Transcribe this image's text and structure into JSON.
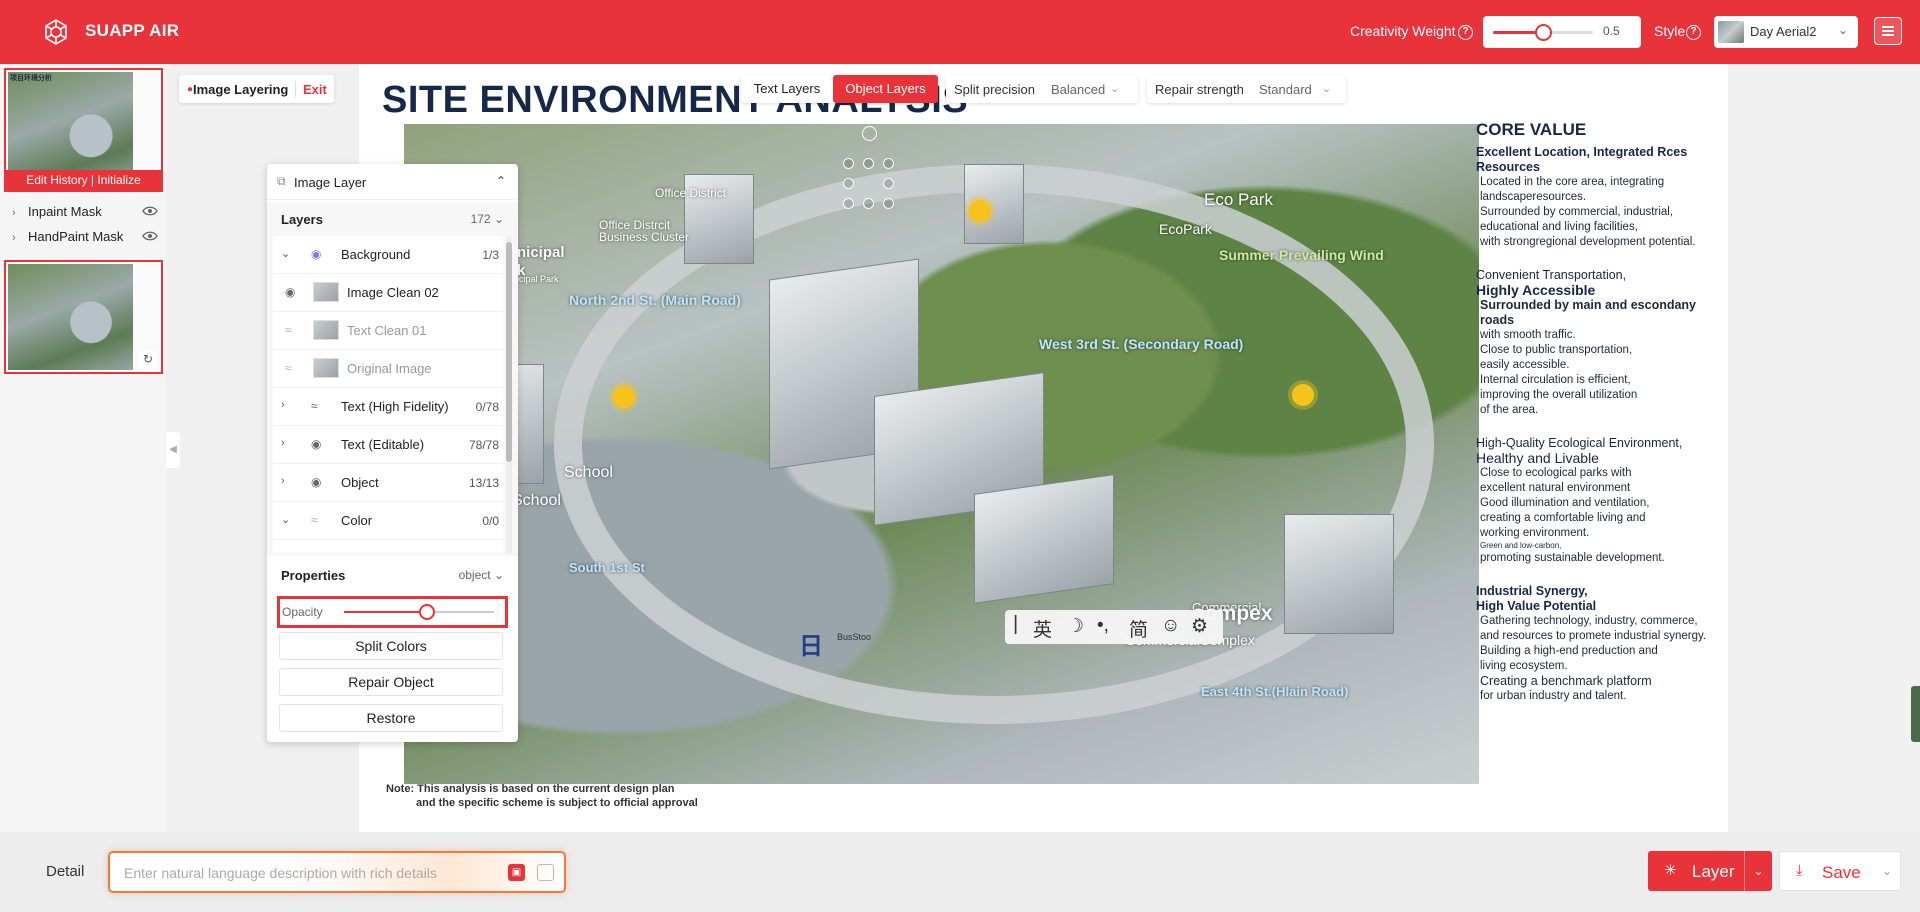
{
  "app": {
    "brand": "SUAPP AIR"
  },
  "header": {
    "creativity_label": "Creativity Weight",
    "creativity_value": "0.5",
    "creativity_fraction": 0.5,
    "style_label": "Style",
    "style_value": "Day Aerial2",
    "accent_color": "#e8333a"
  },
  "history": {
    "banner": "Edit History | Initialize",
    "thumb_title": "项目环境分析",
    "masks": [
      {
        "label": "Inpaint Mask"
      },
      {
        "label": "HandPaint Mask"
      }
    ]
  },
  "mode": {
    "label": "Image Layering",
    "exit": "Exit"
  },
  "toolbar": {
    "text_layers": "Text Layers",
    "object_layers": "Object Layers",
    "split_label": "Split precision",
    "split_value": "Balanced",
    "repair_label": "Repair strength",
    "repair_value": "Standard"
  },
  "layer_panel": {
    "title": "Image Layer",
    "layers_title": "Layers",
    "layers_count": "172",
    "rows": [
      {
        "name": "Background",
        "count": "1/3"
      },
      {
        "name": "Image Clean 02",
        "count": ""
      },
      {
        "name": "Text Clean 01",
        "count": ""
      },
      {
        "name": "Original Image",
        "count": ""
      },
      {
        "name": "Text (High Fidelity)",
        "count": "0/78"
      },
      {
        "name": "Text (Editable)",
        "count": "78/78"
      },
      {
        "name": "Object",
        "count": "13/13"
      },
      {
        "name": "Color",
        "count": "0/0"
      }
    ],
    "properties_title": "Properties",
    "properties_value": "object",
    "opacity_label": "Opacity",
    "opacity_fraction": 0.55,
    "buttons": {
      "split": "Split Colors",
      "repair": "Repair Object",
      "restore": "Restore"
    }
  },
  "canvas": {
    "title": "SITE ENVIRONMENT ANALYSIS",
    "labels": {
      "eco_park": "Eco Park",
      "eco_park2": "EcoPark",
      "office": "Office Distrcit",
      "office2": "Business Cluster",
      "office_icon": "Office District",
      "municipal": "nicipal",
      "municipal2": "k",
      "municipal_park": "icipal Park",
      "north_road": "North 2nd St. (Main Road)",
      "west_road": "West 3rd St. (Secondary Road)",
      "wind": "Summer Prevailing Wind",
      "school": "School",
      "school2": "School",
      "south_road": "South 1st St",
      "commercial": "Commercial",
      "commercial2": "oompex",
      "commercial3": "CommercialComplex",
      "east_road": "East 4th St.(Hlain Road)",
      "bus_stop": "BusStoo"
    },
    "right": {
      "head": "CORE VALUE",
      "s1_title": "Excellent Location, Integrated Rces Resources",
      "s1_items": [
        "Located in the core area, integrating",
        "landscaperesources.",
        "Surrounded by commercial, industrial,",
        "educational and living facilities,",
        "with strongregional development potential."
      ],
      "s2_title": "Convenient Transportation,",
      "s2_title2": "Highly Accessible",
      "s2_items": [
        "Surrounded by main and escondany roads",
        "with smooth traffic.",
        "Close to public transportation,",
        "easily accessible.",
        "Internal circulation is efficient,",
        "improving the overall utilization",
        "of the area."
      ],
      "s3_title": "High-Quality Ecological Environment,",
      "s3_title2": "Healthy and Livable",
      "s3_items": [
        "Close to ecological parks with",
        "excellent natural environment",
        "Good illumination and ventilation,",
        "creating a comfortable living and",
        "working environment.",
        "Green and low-carbon,",
        "promoting sustainable development."
      ],
      "s4_title": "Industrial Synergy,",
      "s4_title2": "High Value Potential",
      "s4_items": [
        "Gathering technology, industry, commerce,",
        "and resources to promete industrial synergy.",
        "Building a high-end preduction and",
        "living ecosystem.",
        "Creating a benchmark platform",
        "for urban industry and talent."
      ]
    },
    "note_line1": "Note: This analysis is based on the current design plan",
    "note_line2": "and the specific scheme is subject to official approval",
    "ime": {
      "en": "英",
      "moon": "☽",
      "punct": "•,",
      "simp": "简",
      "emoji": "☺",
      "gear": "⚙"
    }
  },
  "bottom": {
    "detail_label": "Detail",
    "prompt_placeholder": "Enter natural language description with rich details",
    "layer_button": "Layer",
    "save_button": "Save"
  }
}
